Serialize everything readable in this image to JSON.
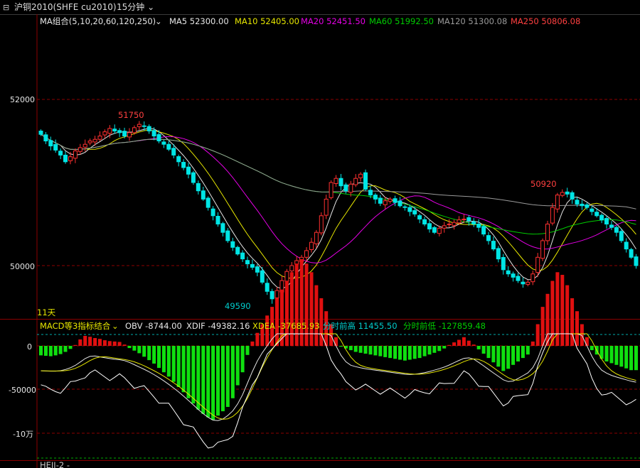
{
  "window": {
    "instrument_icon": "chart-icon",
    "symbol": "沪铜2010(SHFE cu2010)",
    "period": "15分钟"
  },
  "main_panel": {
    "indicator_title": "MA组合(5,10,20,60,120,250)",
    "ma_readouts": [
      {
        "text": "MA5 52300.00",
        "color": "#e6e6e6"
      },
      {
        "text": "MA10 52405.00",
        "color": "#e6e600"
      },
      {
        "text": "MA20 52451.50",
        "color": "#e600e6"
      },
      {
        "text": "MA60 51992.50",
        "color": "#00cc00"
      },
      {
        "text": "MA120 51300.08",
        "color": "#9a9a9a"
      },
      {
        "text": "MA250 50806.08",
        "color": "#ff4040"
      }
    ],
    "y_ticks": [
      "52000",
      "50000"
    ],
    "annotations": {
      "high": "51750",
      "low": "49590",
      "high2": "50920"
    },
    "period_label": "11天"
  },
  "sub_panel": {
    "indicator_title": "MACD等3指标结合",
    "readouts": [
      {
        "text": "OBV -8744.00",
        "color": "#e6e6e6"
      },
      {
        "text": "XDIF -49382.16",
        "color": "#e6e6e6"
      },
      {
        "text": "XDEA -37685.93",
        "color": "#e6e600"
      },
      {
        "text": "分时前高 11455.50",
        "color": "#00cccc"
      },
      {
        "text": "分时前低 -127859.48",
        "color": "#00cc00"
      }
    ],
    "y_ticks": [
      "0",
      "-50000",
      "-10万"
    ]
  },
  "bottom_label": "HEJI-2 -",
  "colors": {
    "up": "#ff3030",
    "down": "#00e5e5",
    "grid": "#8b0000",
    "background": "#000000"
  },
  "chart_data": {
    "type": "candlestick",
    "price_range": [
      49300,
      53100
    ],
    "ma_series": [
      {
        "name": "MA5",
        "color": "#e6e6e6"
      },
      {
        "name": "MA10",
        "color": "#e6e600"
      },
      {
        "name": "MA20",
        "color": "#e600e6"
      },
      {
        "name": "MA60",
        "color": "#00cc00"
      },
      {
        "name": "MA120",
        "color": "#9a9a9a"
      }
    ],
    "closes": [
      51580,
      51500,
      51440,
      51390,
      51330,
      51250,
      51310,
      51380,
      51420,
      51460,
      51500,
      51520,
      51560,
      51610,
      51650,
      51620,
      51600,
      51560,
      51600,
      51660,
      51700,
      51680,
      51620,
      51560,
      51500,
      51460,
      51400,
      51330,
      51250,
      51180,
      51100,
      51000,
      50900,
      50800,
      50700,
      50600,
      50500,
      50400,
      50300,
      50220,
      50140,
      50080,
      50020,
      49980,
      49920,
      49800,
      49690,
      49600,
      49700,
      49820,
      49930,
      50000,
      50060,
      50100,
      50180,
      50280,
      50400,
      50600,
      50800,
      51000,
      51050,
      50960,
      50900,
      50980,
      51050,
      51100,
      50920,
      50850,
      50800,
      50750,
      50780,
      50800,
      50760,
      50720,
      50700,
      50650,
      50620,
      50560,
      50500,
      50440,
      50400,
      50450,
      50480,
      50500,
      50520,
      50550,
      50560,
      50540,
      50500,
      50460,
      50380,
      50300,
      50200,
      50080,
      49950,
      49900,
      49860,
      49820,
      49780,
      49800,
      49900,
      50100,
      50300,
      50500,
      50700,
      50850,
      50880,
      50860,
      50800,
      50740,
      50720,
      50700,
      50650,
      50600,
      50550,
      50500,
      50460,
      50400,
      50300,
      50200,
      50100,
      50000
    ],
    "macd_hist": [
      -11000,
      -11500,
      -12000,
      -11000,
      -9500,
      -7000,
      -3500,
      1000,
      7500,
      11500,
      10500,
      9000,
      8000,
      6500,
      5500,
      5000,
      4500,
      1500,
      -2500,
      -5500,
      -8500,
      -12500,
      -16500,
      -20500,
      -25500,
      -30500,
      -35500,
      -41500,
      -47500,
      -53500,
      -60500,
      -66500,
      -73500,
      -78500,
      -82500,
      -85500,
      -80500,
      -75500,
      -70500,
      -60500,
      -45500,
      -30500,
      -10500,
      5000,
      15000,
      25000,
      35000,
      45000,
      55000,
      65000,
      75000,
      85000,
      95000,
      100000,
      95000,
      85000,
      70000,
      55000,
      40000,
      25000,
      10000,
      -1000,
      -3000,
      -5000,
      -7000,
      -8000,
      -9000,
      -10000,
      -11000,
      -12000,
      -13000,
      -14000,
      -15000,
      -16000,
      -17000,
      -16000,
      -15000,
      -14000,
      -12000,
      -10000,
      -8000,
      -6000,
      -3000,
      1000,
      4000,
      7000,
      10000,
      6000,
      1500,
      -4000,
      -9000,
      -14000,
      -19000,
      -24000,
      -29000,
      -26500,
      -22000,
      -18000,
      -14000,
      -10000,
      5000,
      25000,
      45000,
      60000,
      75000,
      85000,
      82000,
      70000,
      55000,
      40000,
      25000,
      10000,
      -5000,
      -10000,
      -15000,
      -18000,
      -20000,
      -22000,
      -24000,
      -26000,
      -28000,
      -28000
    ]
  }
}
